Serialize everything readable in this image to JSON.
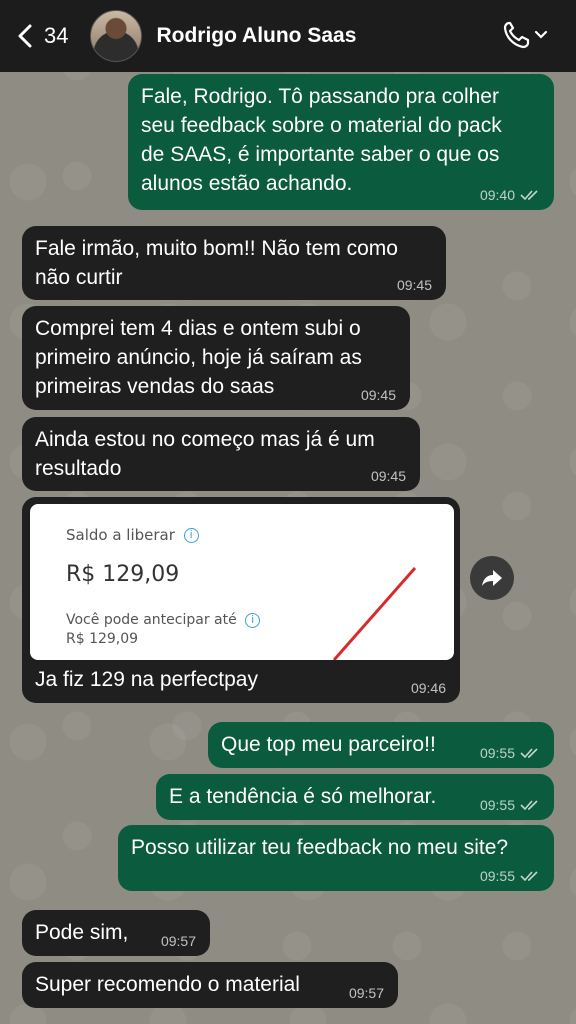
{
  "header": {
    "back_count": "34",
    "contact_name": "Rodrigo Aluno Saas"
  },
  "messages": [
    {
      "dir": "out",
      "text": "Fale, Rodrigo. Tô passando pra colher\nseu feedback sobre o material do pack\nde SAAS, é importante saber o que os\nalunos estão achando.",
      "time": "09:40"
    },
    {
      "dir": "in",
      "text": "Fale irmão, muito bom!! Não tem como\nnão curtir",
      "time": "09:45"
    },
    {
      "dir": "in",
      "text": "Comprei tem 4 dias e ontem subi o\nprimeiro anúncio, hoje já saíram as\nprimeiras vendas do saas",
      "time": "09:45"
    },
    {
      "dir": "in",
      "text": "Ainda estou no começo mas já é um\nresultado",
      "time": "09:45"
    },
    {
      "dir": "in",
      "text": "Ja fiz 129 na perfectpay",
      "time": "09:46"
    },
    {
      "dir": "out",
      "text": "Que top meu parceiro!!",
      "time": "09:55"
    },
    {
      "dir": "out",
      "text": "E a tendência é só melhorar.",
      "time": "09:55"
    },
    {
      "dir": "out",
      "text": "Posso utilizar teu feedback no meu site?",
      "time": "09:55"
    },
    {
      "dir": "in",
      "text": "Pode sim,",
      "time": "09:57"
    },
    {
      "dir": "in",
      "text": "Super recomendo o material",
      "time": "09:57"
    }
  ],
  "image_card": {
    "label": "Saldo a liberar",
    "amount": "R$ 129,09",
    "sub_label": "Você pode antecipar até",
    "sub_amount": "R$ 129,09"
  },
  "icons": {
    "info": "i"
  },
  "colors": {
    "incoming_bubble": "#1f1f1f",
    "outgoing_bubble": "#0b5b3e",
    "header": "#1c1c1c",
    "wallpaper": "#8f8c84"
  }
}
